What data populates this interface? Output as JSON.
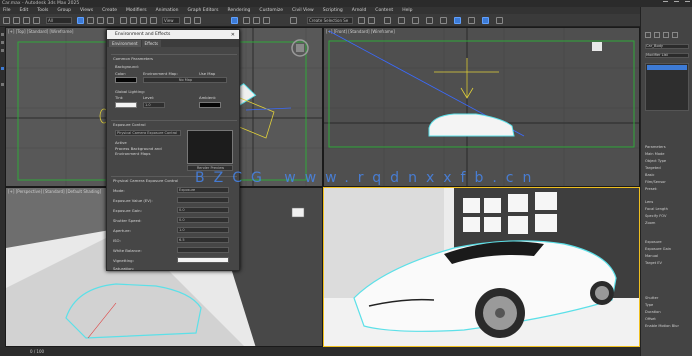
{
  "titlebar": {
    "title": "Car.max - Autodesk 3ds Max 2025"
  },
  "menubar": {
    "items": [
      "File",
      "Edit",
      "Tools",
      "Group",
      "Views",
      "Create",
      "Modifiers",
      "Animation",
      "Graph Editors",
      "Rendering",
      "Customize",
      "Civil View",
      "Scripting",
      "Arnold",
      "Content",
      "Help"
    ]
  },
  "toolbar": {
    "selection_filter": "All",
    "view_dropdown": "View",
    "named_selection": "Create Selection Se"
  },
  "viewports": {
    "top_left": "[+] [Top] [Standard] [Wireframe]",
    "top_right": "[+] [Front] [Standard] [Wireframe]",
    "bottom_left": "[+] [Perspective] [Standard] [Default Shading]",
    "bottom_right": "[+] [PhysCamera001] [Standard] [Default Shading]"
  },
  "dialog": {
    "title": "Environment and Effects",
    "tabs": [
      "Environment",
      "Effects"
    ],
    "common_params": "Common Parameters",
    "background": "Background:",
    "color_label": "Color:",
    "env_map_label": "Environment Map:",
    "use_map": "Use Map",
    "no_map": "No Map",
    "global_lighting": "Global Lighting:",
    "tint": "Tint:",
    "level": "Level:",
    "level_val": "1.0",
    "ambient": "Ambient:",
    "exposure_control": "Exposure Control",
    "exposure_type": "Physical Camera Exposure Control",
    "active": "Active",
    "process_bg": "Process Background and Environment Maps",
    "render_preview": "Render Preview",
    "arnold_section": "Physical Camera Exposure Control",
    "rows": [
      {
        "label": "Mode:",
        "value": "Exposure"
      },
      {
        "label": "Exposure Value (EV):",
        "value": ""
      },
      {
        "label": "Exposure Gain:",
        "value": "0.0"
      },
      {
        "label": "Shutter Speed:",
        "value": "0.0"
      },
      {
        "label": "Aperture:",
        "value": "1.0"
      },
      {
        "label": "ISO:",
        "value": "6.5"
      },
      {
        "label": "White Balance:",
        "value": ""
      },
      {
        "label": "Vignetting:",
        "value": ""
      },
      {
        "label": "Saturation:",
        "value": ""
      }
    ]
  },
  "cmdpanel": {
    "object_name": "Car_Body",
    "modifier_list": "Modifier List",
    "lines": [
      "Parameters",
      "Main Mode",
      "Object Type",
      "Targeted",
      "Basic",
      "Film/Sensor",
      "Preset:",
      "Lens",
      "Focal Length",
      "Specify FOV",
      "Zoom",
      "Exposure",
      "Exposure Gain",
      "Manual",
      "Target EV",
      "Shutter",
      "Type",
      "Duration",
      "Offset",
      "Enable Motion Blur"
    ]
  },
  "watermark": "BZCG  www.rqdnxxfb.cn",
  "statusbar": {
    "text": "0 / 100"
  }
}
